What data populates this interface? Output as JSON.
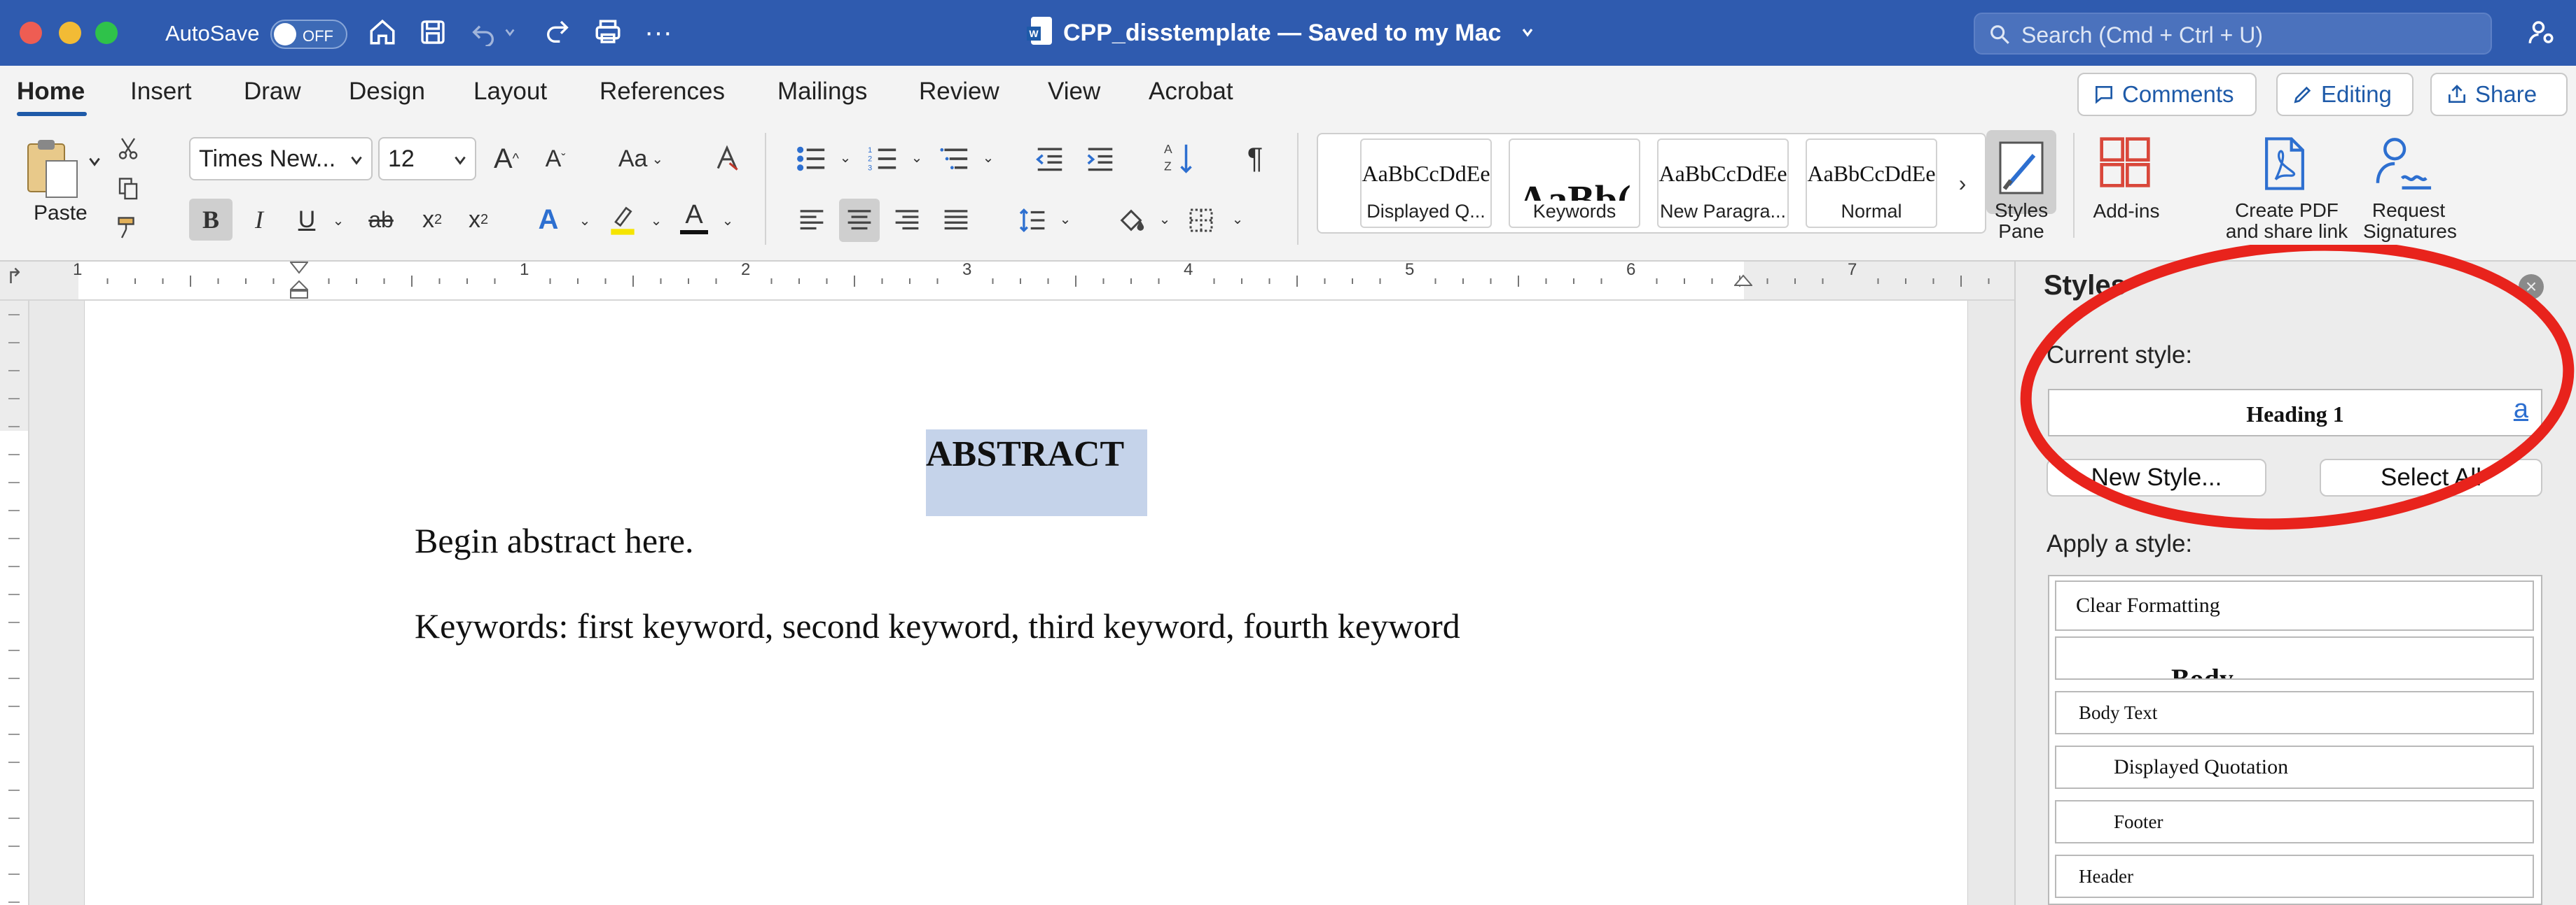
{
  "titlebar": {
    "autosave_label": "AutoSave",
    "autosave_state": "OFF",
    "doc_title": "CPP_disstemplate — Saved to my Mac",
    "search_placeholder": "Search (Cmd + Ctrl + U)"
  },
  "tabs": [
    "Home",
    "Insert",
    "Draw",
    "Design",
    "Layout",
    "References",
    "Mailings",
    "Review",
    "View",
    "Acrobat"
  ],
  "header_buttons": {
    "comments": "Comments",
    "editing": "Editing",
    "share": "Share"
  },
  "ribbon": {
    "paste_label": "Paste",
    "font_name": "Times New...",
    "font_size": "12",
    "change_case": "Aa",
    "bold": "B",
    "italic": "I",
    "underline": "U",
    "strike": "ab",
    "subscript": "x",
    "sub_mark": "2",
    "superscript": "x",
    "sup_mark": "2",
    "text_effects": "A",
    "font_color": "A",
    "styles_gallery": [
      {
        "preview": "AaBbCcDdEe",
        "name": "Displayed Q..."
      },
      {
        "preview": "AaBb(",
        "name": "Keywords"
      },
      {
        "preview": "AaBbCcDdEe",
        "name": "New Paragra..."
      },
      {
        "preview": "AaBbCcDdEe",
        "name": "Normal"
      }
    ],
    "styles_pane_label": "Styles\nPane",
    "addins_label": "Add-ins",
    "create_pdf_label": "Create PDF\nand share link",
    "request_sig_label": "Request\nSignatures"
  },
  "ruler_numbers": [
    "1",
    "1",
    "2",
    "3",
    "4",
    "5",
    "6",
    "7"
  ],
  "document": {
    "heading": "ABSTRACT",
    "body": "Begin abstract here.",
    "keywords": "Keywords: first keyword, second keyword, third keyword, fourth keyword"
  },
  "styles_pane": {
    "title": "Styles",
    "current_style_label": "Current style:",
    "current_style": "Heading 1",
    "style_icon": "a",
    "new_style": "New Style...",
    "select_all": "Select All",
    "apply_label": "Apply a style:",
    "styles": [
      "Clear Formatting",
      "Body",
      "Body Text",
      "Displayed Quotation",
      "Footer",
      "Header"
    ]
  },
  "colors": {
    "titlebar": "#2f5baf",
    "accent": "#1e5aa8",
    "annotation_circle": "#e8231c",
    "selection": "#c5d3ea"
  }
}
